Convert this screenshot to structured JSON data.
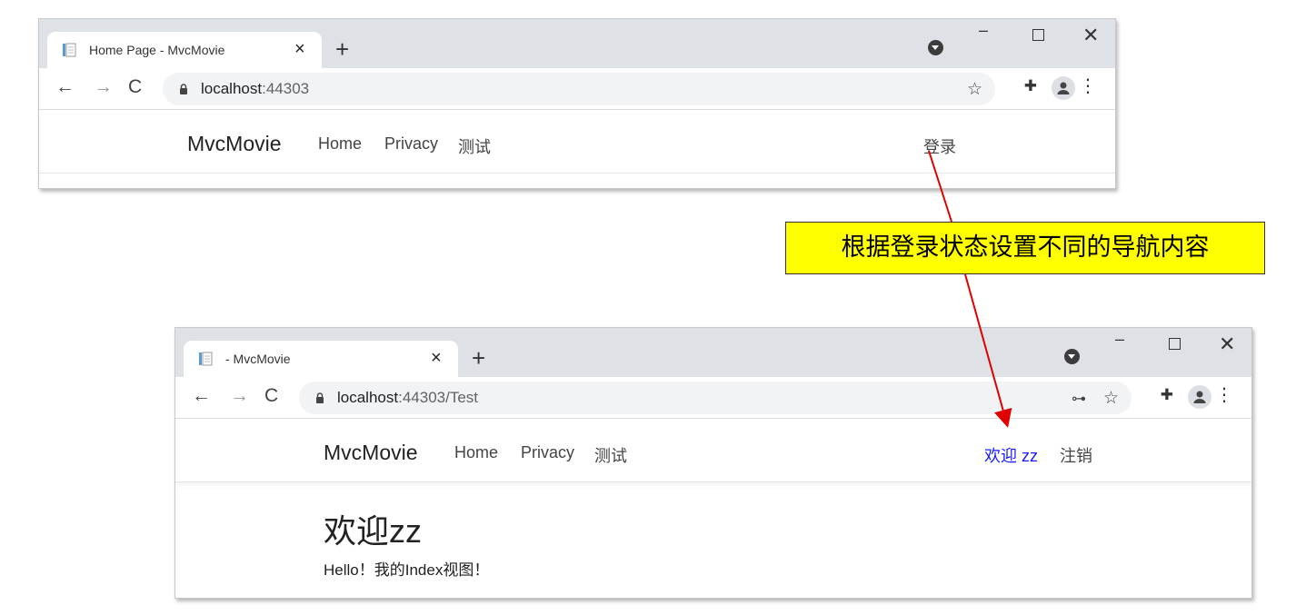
{
  "window1": {
    "tab_title": "Home Page - MvcMovie",
    "tab_close": "×",
    "newtab": "+",
    "url_host": "localhost",
    "url_rest": ":44303",
    "site": {
      "brand": "MvcMovie",
      "nav": [
        "Home",
        "Privacy",
        "测试"
      ],
      "right_links": [
        "登录"
      ]
    }
  },
  "window2": {
    "tab_title": "- MvcMovie",
    "tab_close": "×",
    "newtab": "+",
    "url_host": "localhost",
    "url_rest": ":44303/Test",
    "site": {
      "brand": "MvcMovie",
      "nav": [
        "Home",
        "Privacy",
        "测试"
      ],
      "right_links": [
        "欢迎 zz",
        "注销"
      ]
    },
    "page": {
      "heading": "欢迎zz",
      "paragraph": "Hello！我的Index视图！"
    }
  },
  "callout": "根据登录状态设置不同的导航内容",
  "colors": {
    "callout_bg": "#ffff00",
    "arrow": "#e00000",
    "welcome_link": "#1a1aff",
    "tabstrip": "#dee1e6"
  },
  "icons": {
    "back": "←",
    "forward": "→",
    "reload": "C",
    "star": "☆",
    "key": "⊶",
    "extensions": "✚",
    "menu": "⋮",
    "min": "–",
    "close": "✕"
  }
}
